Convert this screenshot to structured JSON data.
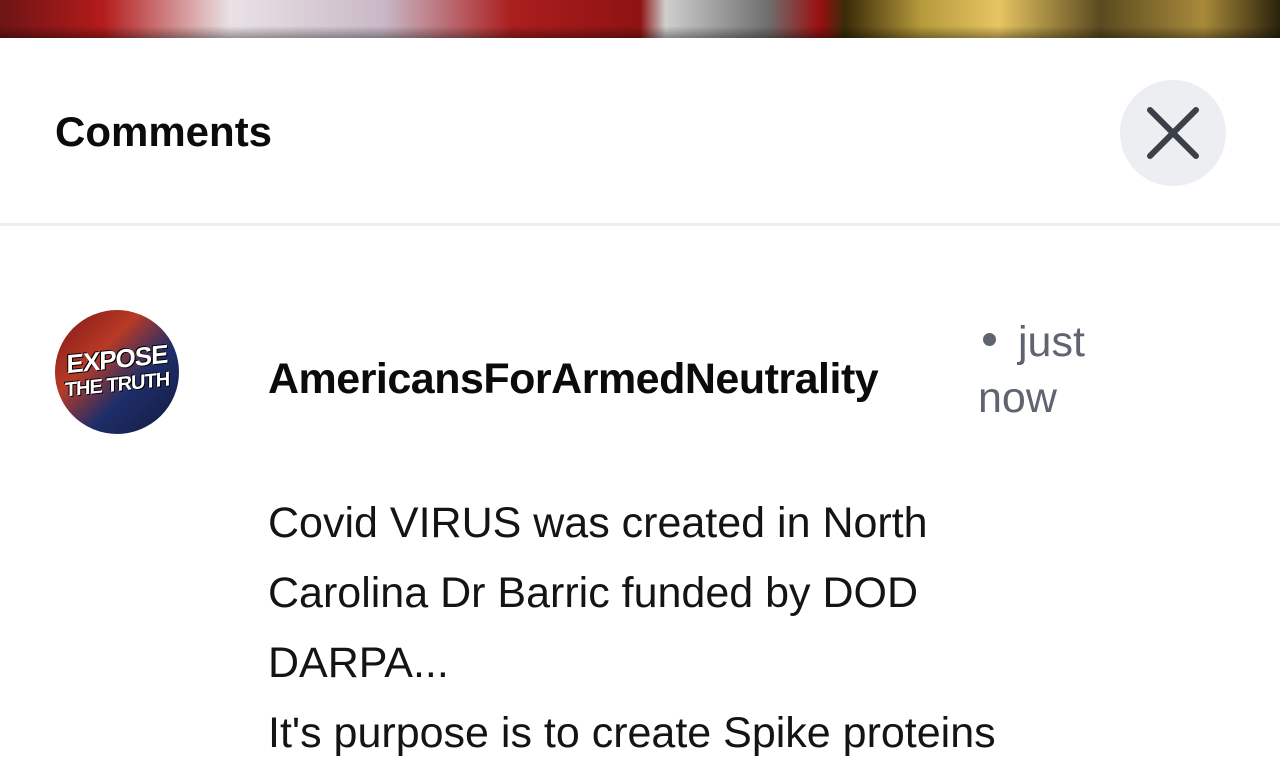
{
  "panel": {
    "title": "Comments",
    "close_icon": "close-icon"
  },
  "comment": {
    "avatar_line1": "EXPOSE",
    "avatar_line2": "THE TRUTH",
    "username": "AmericansForArmedNeutrality",
    "time_line1": "just",
    "time_line2": "now",
    "text_lines": [
      "Covid VIRUS was created in North",
      "Carolina Dr Barric funded by DOD",
      "DARPA...",
      "It's purpose is to create Spike proteins"
    ]
  },
  "colors": {
    "title": "#0b0b0b",
    "muted": "#5f6470",
    "close_bg": "#edeef1",
    "divider": "#eceef1"
  }
}
